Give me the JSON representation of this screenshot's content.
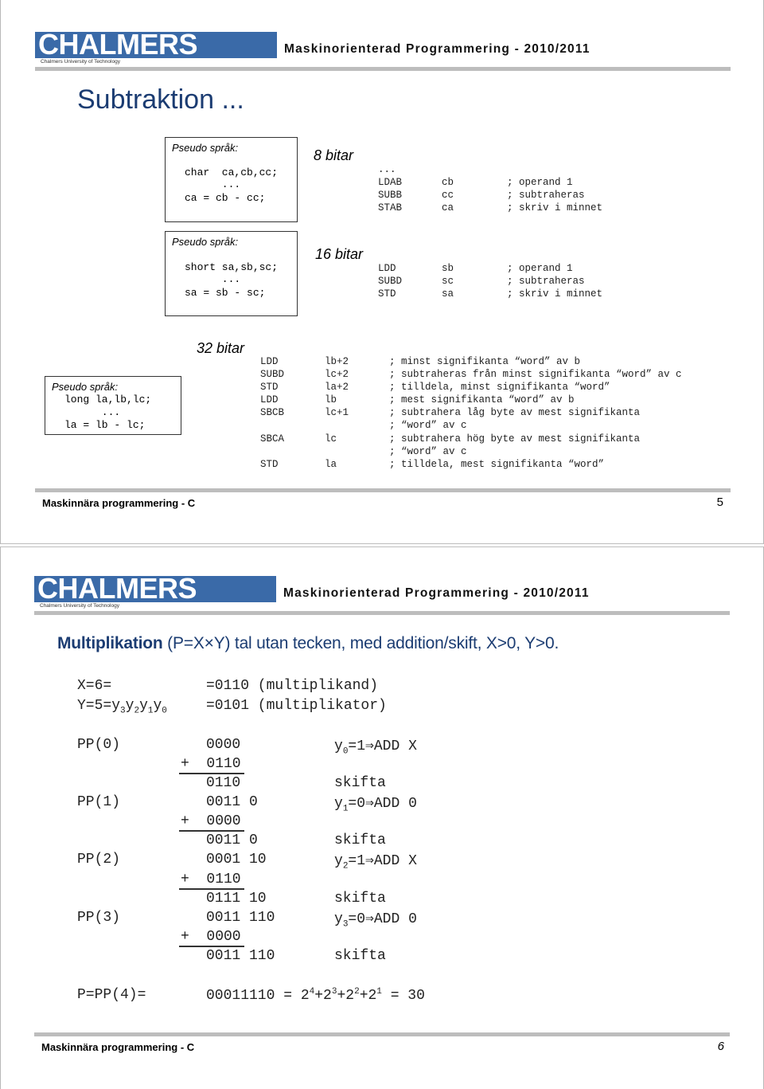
{
  "header": {
    "logo_text": "CHALMERS",
    "logo_subtitle": "Chalmers University of Technology",
    "course_title": "Maskinorienterad Programmering - 2010/2011"
  },
  "footer": {
    "course_name": "Maskinnära programmering - C"
  },
  "slide1": {
    "title": "Subtraktion ...",
    "page_number": "5",
    "sections": [
      {
        "bits_label": "8 bitar",
        "pseudo_label": "Pseudo språk:",
        "pseudo_lines": [
          "char  ca,cb,cc;",
          "      ...",
          "ca = cb - cc;"
        ],
        "asm_lines": [
          {
            "op": "...",
            "arg": "",
            "comment": ""
          },
          {
            "op": "LDAB",
            "arg": "cb",
            "comment": "; operand 1"
          },
          {
            "op": "SUBB",
            "arg": "cc",
            "comment": "; subtraheras"
          },
          {
            "op": "STAB",
            "arg": "ca",
            "comment": "; skriv i minnet"
          }
        ]
      },
      {
        "bits_label": "16 bitar",
        "pseudo_label": "Pseudo språk:",
        "pseudo_lines": [
          "short sa,sb,sc;",
          "      ...",
          "sa = sb - sc;"
        ],
        "asm_lines": [
          {
            "op": "LDD",
            "arg": "sb",
            "comment": "; operand 1"
          },
          {
            "op": "SUBD",
            "arg": "sc",
            "comment": "; subtraheras"
          },
          {
            "op": "STD",
            "arg": "sa",
            "comment": "; skriv i minnet"
          }
        ]
      },
      {
        "bits_label": "32 bitar",
        "pseudo_label": "Pseudo språk:",
        "pseudo_lines": [
          "long la,lb,lc;",
          "      ...",
          "la = lb - lc;"
        ],
        "asm_lines": [
          {
            "op": "LDD",
            "arg": "lb+2",
            "comment": "; minst signifikanta “word” av b"
          },
          {
            "op": "SUBD",
            "arg": "lc+2",
            "comment": "; subtraheras från minst signifikanta “word” av c"
          },
          {
            "op": "STD",
            "arg": "la+2",
            "comment": "; tilldela, minst signifikanta “word”"
          },
          {
            "op": "LDD",
            "arg": "lb",
            "comment": "; mest signifikanta “word” av b"
          },
          {
            "op": "SBCB",
            "arg": "lc+1",
            "comment": "; subtrahera låg byte av mest signifikanta"
          },
          {
            "op": "",
            "arg": "",
            "comment": "; “word” av c"
          },
          {
            "op": "SBCA",
            "arg": "lc",
            "comment": "; subtrahera hög byte av mest signifikanta"
          },
          {
            "op": "",
            "arg": "",
            "comment": "; “word” av c"
          },
          {
            "op": "STD",
            "arg": "la",
            "comment": "; tilldela, mest signifikanta “word”"
          }
        ]
      }
    ]
  },
  "slide2": {
    "title_bold": "Multiplikation",
    "title_rest": " (P=X×Y) tal utan tecken, med addition/skift, X>0, Y>0.",
    "page_number": "6",
    "x_def": {
      "label": "X=6=",
      "value": "=0110 (multiplikand)"
    },
    "y_def": {
      "label_prefix": "Y=5=",
      "value": "=0101 (multiplikator)"
    },
    "steps": [
      {
        "label": "PP(0)",
        "value": "0000",
        "note_bit": "0",
        "note": "=1⇒ADD X"
      },
      {
        "label": "",
        "value": "+  0110",
        "note": "",
        "underline": true
      },
      {
        "label": "",
        "value": "0110",
        "note": "skifta"
      },
      {
        "label": "PP(1)",
        "value": "0011 0",
        "note_bit": "1",
        "note": "=0⇒ADD 0"
      },
      {
        "label": "",
        "value": "+  0000",
        "note": "",
        "underline": true
      },
      {
        "label": "",
        "value": "0011 0",
        "note": "skifta"
      },
      {
        "label": "PP(2)",
        "value": "0001 10",
        "note_bit": "2",
        "note": "=1⇒ADD X"
      },
      {
        "label": "",
        "value": "+  0110",
        "note": "",
        "underline": true
      },
      {
        "label": "",
        "value": "0111 10",
        "note": "skifta"
      },
      {
        "label": "PP(3)",
        "value": "0011 110",
        "note_bit": "3",
        "note": "=0⇒ADD 0"
      },
      {
        "label": "",
        "value": "+  0000",
        "note": "",
        "underline": true
      },
      {
        "label": "",
        "value": "0011 110",
        "note": "skifta"
      }
    ],
    "result": {
      "label": "P=PP(4)=",
      "binary": "00011110",
      "equals": " = ",
      "terms": [
        "2",
        "4",
        "+2",
        "3",
        "+2",
        "2",
        "+2",
        "1"
      ],
      "total": " = 30"
    }
  }
}
